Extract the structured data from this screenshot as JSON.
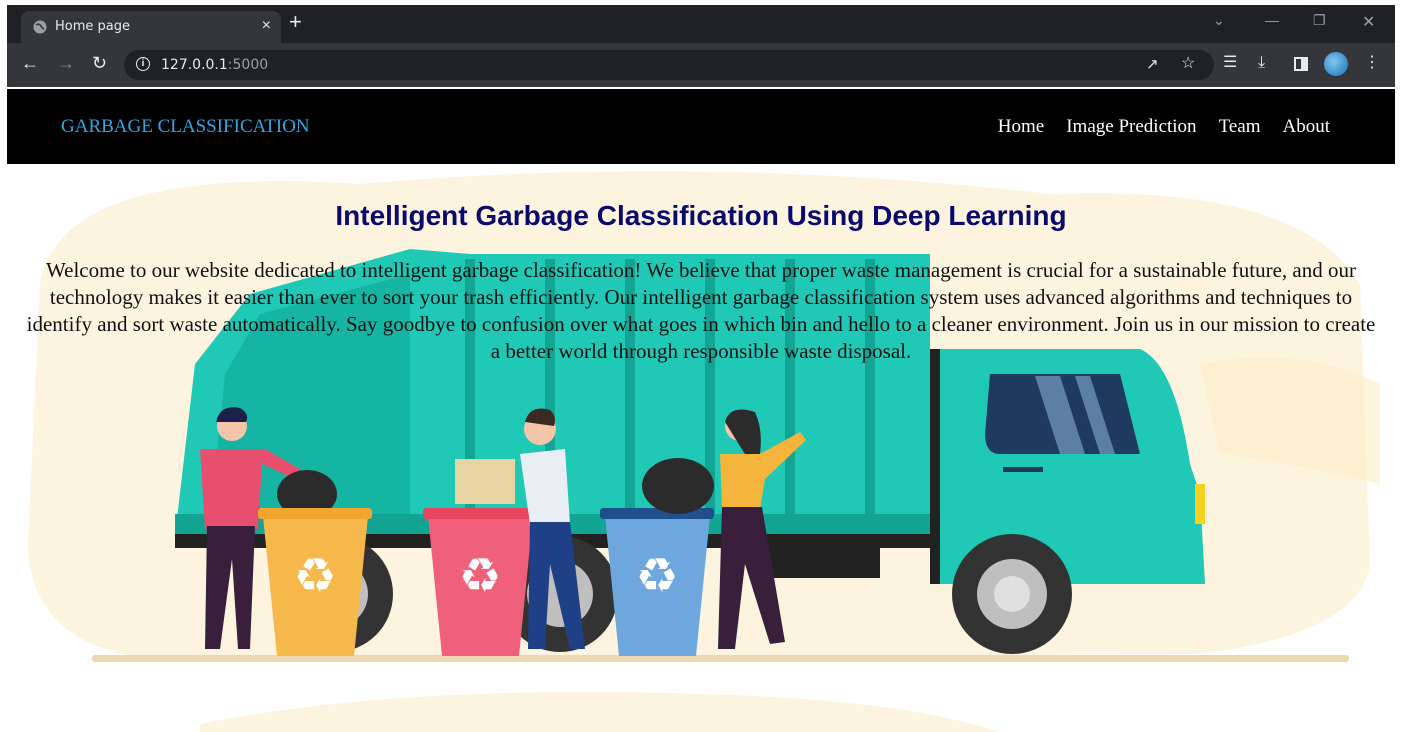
{
  "browser": {
    "tab_title": "Home page",
    "tab_close": "×",
    "new_tab": "+",
    "url_host": "127.0.0.1",
    "url_port": ":5000",
    "icons": [
      "globe-icon",
      "back-icon",
      "forward-icon",
      "reload-icon",
      "info-icon",
      "share-icon",
      "star-icon",
      "media-icon",
      "download-icon",
      "sidepanel-icon",
      "avatar",
      "menu-icon"
    ]
  },
  "navbar": {
    "brand": "GARBAGE CLASSIFICATION",
    "links": [
      "Home",
      "Image Prediction",
      "Team",
      "About"
    ],
    "brand_color": "#2fa7e4"
  },
  "hero": {
    "title": "Intelligent Garbage Classification Using Deep Learning",
    "text": "Welcome to our website dedicated to intelligent garbage classification! We believe that proper waste management is crucial for a sustainable future, and our technology makes it easier than ever to sort your trash efficiently. Our intelligent garbage classification system uses advanced algorithms and techniques to identify and sort waste automatically. Say goodbye to confusion over what goes in which bin and hello to a cleaner environment. Join us in our mission to create a better world through responsible waste disposal.",
    "title_color": "#0a0a6e",
    "truck_color": "#1fc9b6"
  }
}
